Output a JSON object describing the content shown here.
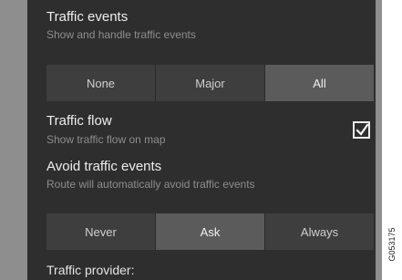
{
  "traffic_events": {
    "title": "Traffic events",
    "subtitle": "Show and handle traffic events",
    "options": [
      "None",
      "Major",
      "All"
    ],
    "selected": "All"
  },
  "traffic_flow": {
    "title": "Traffic flow",
    "subtitle": "Show traffic flow on map",
    "checked": true
  },
  "avoid_traffic_events": {
    "title": "Avoid traffic events",
    "subtitle": "Route will automatically avoid traffic events",
    "options": [
      "Never",
      "Ask",
      "Always"
    ],
    "selected": "Ask"
  },
  "traffic_provider": {
    "title": "Traffic provider:"
  },
  "figure_code": "G053175",
  "colors": {
    "panel_bg": "#2e2e2e",
    "segment_bg": "#3e3e3e",
    "segment_selected_bg": "#5b5b5b",
    "side_strip": "#8e8e8e"
  }
}
